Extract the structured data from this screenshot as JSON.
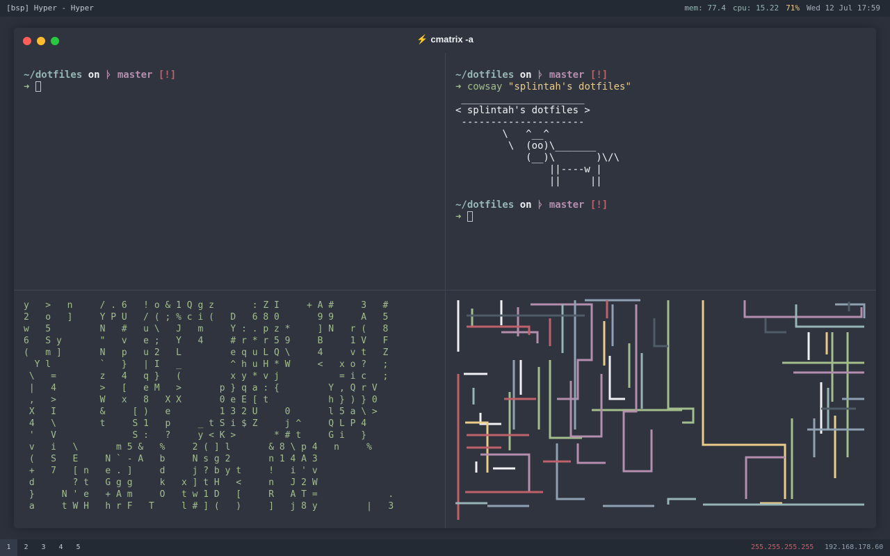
{
  "topbar": {
    "title": "[bsp] Hyper - Hyper",
    "mem": "mem: 77.4",
    "cpu": "cpu: 15.22",
    "battery": "71%",
    "datetime": "Wed 12 Jul  17:59"
  },
  "window": {
    "title": "cmatrix -a",
    "title_icon": "lightning-bolt-icon"
  },
  "panes": {
    "top_left": {
      "prompt_dir": "~/dotfiles",
      "prompt_on": "on",
      "prompt_branch_icon": "git-branch-icon",
      "prompt_branch": "master",
      "prompt_status": "[!]",
      "prompt_arrow": "➜"
    },
    "top_right": {
      "prompt_dir": "~/dotfiles",
      "prompt_on": "on",
      "prompt_branch": "master",
      "prompt_status": "[!]",
      "prompt_arrow": "➜",
      "command": "cowsay",
      "command_arg": "\"splintah's dotfiles\"",
      "cowsay_output": " _____________________\n< splintah's dotfiles >\n ---------------------\n        \\   ^__^\n         \\  (oo)\\_______\n            (__)\\       )\\/\\\n                ||----w |\n                ||     ||",
      "prompt2_dir": "~/dotfiles",
      "prompt2_on": "on",
      "prompt2_branch": "master",
      "prompt2_status": "[!]",
      "prompt2_arrow": "➜"
    },
    "bottom_left": {
      "matrix_text": "y   >   n     / . 6   ! o & 1 Q g z       : Z I     + A #     3   #\n2   o   ]     Y P U   / ( ; % c i (   D   6 8 0       9 9     A   5\nw   5         N   #   u \\   J   m     Y : . p z *     ] N   r (   8\n6   S y       \"   v   e ;   Y   4     # r * r 5 9     B     1 V   F\n(   m ]       N   p   u 2   L         e q u L Q \\     4     v t   Z\n  Y l         `   }   | I   _         ^ h u H * W     <   x o ?   ;\n \\   =        z   4   q }   (         x y * v j           = i c   ;\n |   4        >   [   e M   >       p } q a : {         Y , Q r V\n ,   >        W   x   8   X X       0 e E [ t           h } ) } 0\n X   I        &     [ )   e         1 3 2 U     0       l 5 a \\ >\n 4   \\        t     S 1   p     _ t S i $ Z     j ^     Q L P 4\n '   V              S :   ?     y < K >       * # t     G i   }\n v   i   \\       m 5 &   %     2 ( ] l       & 8 \\ p 4   n     %\n (   S   E     N ` - A   b     N s g 2       n 1 4 A 3\n +   7   [ n   e . ]     d     j ? b y t     !   i ' v\n d       ? t   G g g     k   x ] t H   <     n   J 2 W\n }     N ' e   + A m     O   t w 1 D   [     R   A T =             .\n a     t W H   h r F   T     l # ] (   )     ]   j 8 y         |   3"
    },
    "bottom_right": {
      "content": "pipes-animation"
    }
  },
  "bottombar": {
    "workspaces": [
      "1",
      "2",
      "3",
      "4",
      "5"
    ],
    "active_workspace": "1",
    "ip_mask": "255.255.255.255",
    "ip_addr": "192.168.178.60"
  },
  "colors": {
    "bg": "#2b303b",
    "cyan": "#96b5b4",
    "magenta": "#b48ead",
    "red": "#bf616a",
    "green": "#a3be8c",
    "yellow": "#ebcb8b",
    "blue": "#8fa1b3"
  }
}
